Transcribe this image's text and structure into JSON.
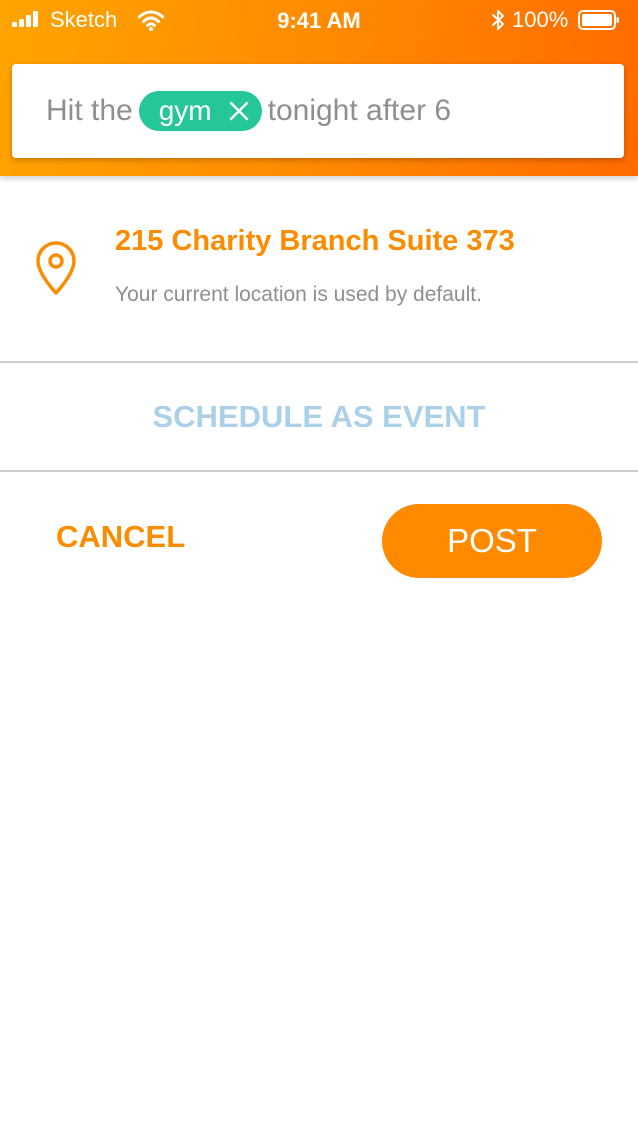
{
  "status_bar": {
    "carrier": "Sketch",
    "time": "9:41 AM",
    "battery": "100%"
  },
  "composer": {
    "text_before": "Hit the",
    "tag": "gym",
    "text_after": "tonight after 6"
  },
  "location": {
    "address": "215 Charity Branch Suite 373",
    "note": "Your current location is used by default."
  },
  "actions": {
    "schedule_label": "SCHEDULE AS EVENT",
    "cancel_label": "CANCEL",
    "post_label": "POST"
  },
  "colors": {
    "accent": "#fb8c00",
    "tag": "#25c79a",
    "schedule": "#aad1e8"
  },
  "icons": {
    "signal": "signal-bars-icon",
    "wifi": "wifi-icon",
    "bluetooth": "bluetooth-icon",
    "battery": "battery-icon",
    "tag_remove": "close-icon",
    "location": "map-pin-icon"
  }
}
